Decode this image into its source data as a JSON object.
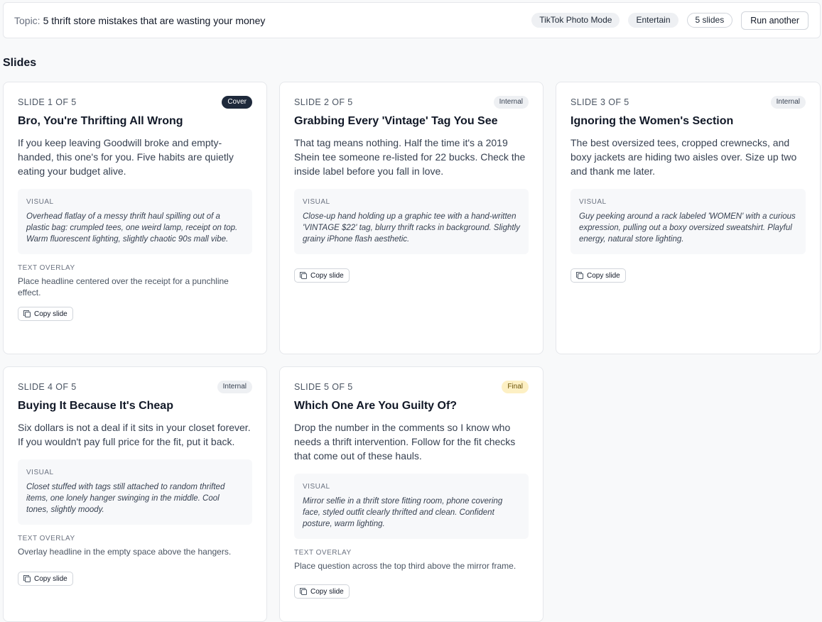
{
  "topbar": {
    "topic_label": "Topic:",
    "topic_value": "5 thrift store mistakes that are wasting your money",
    "pills": [
      "TikTok Photo Mode",
      "Entertain",
      "5 slides"
    ],
    "run_button": "Run another"
  },
  "section_title": "Slides",
  "labels": {
    "visual": "VISUAL",
    "text_overlay": "TEXT OVERLAY",
    "copy_slide": "Copy slide"
  },
  "colors": {
    "cover_badge_bg": "#1e293b",
    "final_badge_bg": "#fdf0c4",
    "internal_badge_bg": "#eef0f3"
  },
  "slides": [
    {
      "number": "SLIDE 1 OF 5",
      "badge": "Cover",
      "title": "Bro, You're Thrifting All Wrong",
      "body": "If you keep leaving Goodwill broke and empty-handed, this one's for you. Five habits are quietly eating your budget alive.",
      "visual": "Overhead flatlay of a messy thrift haul spilling out of a plastic bag: crumpled tees, one weird lamp, receipt on top. Warm fluorescent lighting, slightly chaotic 90s mall vibe.",
      "text_overlay": "Place headline centered over the receipt for a punchline effect."
    },
    {
      "number": "SLIDE 2 OF 5",
      "badge": "Internal",
      "title": "Grabbing Every 'Vintage' Tag You See",
      "body": "That tag means nothing. Half the time it's a 2019 Shein tee someone re-listed for 22 bucks. Check the inside label before you fall in love.",
      "visual": "Close-up hand holding up a graphic tee with a hand-written 'VINTAGE $22' tag, blurry thrift racks in background. Slightly grainy iPhone flash aesthetic."
    },
    {
      "number": "SLIDE 3 OF 5",
      "badge": "Internal",
      "title": "Ignoring the Women's Section",
      "body": "The best oversized tees, cropped crewnecks, and boxy jackets are hiding two aisles over. Size up two and thank me later.",
      "visual": "Guy peeking around a rack labeled 'WOMEN' with a curious expression, pulling out a boxy oversized sweatshirt. Playful energy, natural store lighting."
    },
    {
      "number": "SLIDE 4 OF 5",
      "badge": "Internal",
      "title": "Buying It Because It's Cheap",
      "body": "Six dollars is not a deal if it sits in your closet forever. If you wouldn't pay full price for the fit, put it back.",
      "visual": "Closet stuffed with tags still attached to random thrifted items, one lonely hanger swinging in the middle. Cool tones, slightly moody.",
      "text_overlay": "Overlay headline in the empty space above the hangers."
    },
    {
      "number": "SLIDE 5 OF 5",
      "badge": "Final",
      "title": "Which One Are You Guilty Of?",
      "body": "Drop the number in the comments so I know who needs a thrift intervention. Follow for the fit checks that come out of these hauls.",
      "visual": "Mirror selfie in a thrift store fitting room, phone covering face, styled outfit clearly thrifted and clean. Confident posture, warm lighting.",
      "text_overlay": "Place question across the top third above the mirror frame."
    }
  ]
}
